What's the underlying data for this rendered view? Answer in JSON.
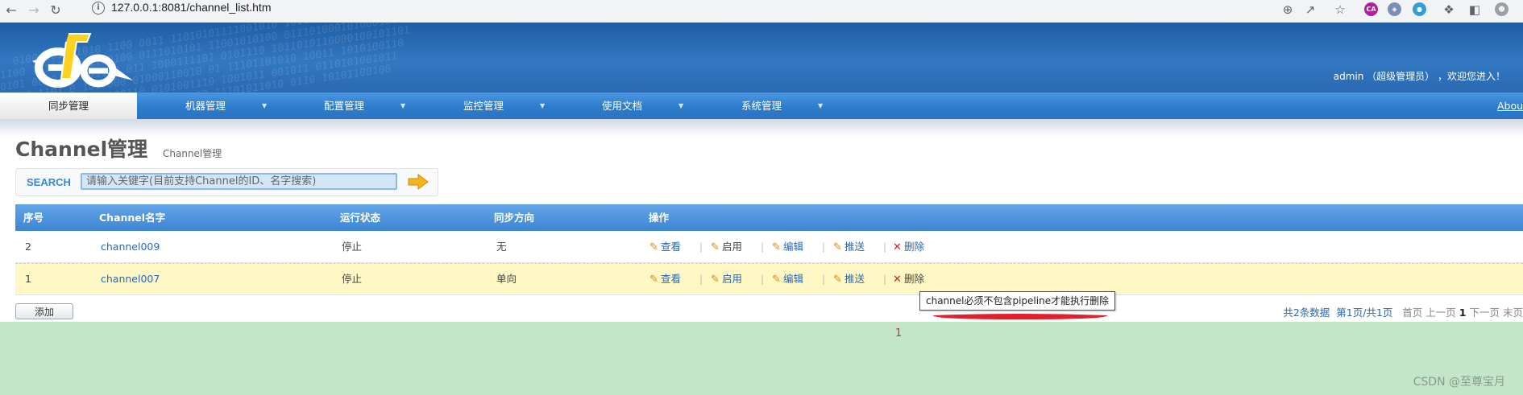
{
  "browser": {
    "url": "127.0.0.1:8081/channel_list.htm"
  },
  "header": {
    "user_info": "admin （超级管理员） ，欢迎您进入！"
  },
  "nav": {
    "items": [
      "同步管理",
      "机器管理",
      "配置管理",
      "监控管理",
      "使用文档",
      "系统管理"
    ],
    "about": "Abou"
  },
  "page": {
    "title": "Channel管理",
    "subtitle": "Channel管理"
  },
  "search": {
    "label": "SEARCH",
    "placeholder": "请输入关键字(目前支持Channel的ID、名字搜索)"
  },
  "table": {
    "headers": [
      "序号",
      "Channel名字",
      "运行状态",
      "同步方向",
      "操作"
    ],
    "rows": [
      {
        "id": "2",
        "name": "channel009",
        "status": "停止",
        "direction": "无"
      },
      {
        "id": "1",
        "name": "channel007",
        "status": "停止",
        "direction": "单向"
      }
    ],
    "ops": {
      "view": "查看",
      "enable": "启用",
      "edit": "编辑",
      "push": "推送",
      "delete": "删除"
    }
  },
  "tooltip": "channel必须不包含pipeline才能执行删除",
  "add_button": "添加",
  "pager": {
    "total": "共2条数据",
    "pages": "第1页/共1页",
    "first": "首页",
    "prev": "上一页",
    "current": "1",
    "next": "下一页",
    "last": "末页"
  },
  "footer": {
    "page_number": "1",
    "watermark": "CSDN @至尊宝月"
  },
  "colors": {
    "header_blue": "#2a6ab2",
    "nav_blue": "#2d7ccb",
    "link": "#2a67b1",
    "highlight_row": "#fff8c5",
    "footer_green": "#c4e6c8",
    "annotation_red": "#e0212b"
  }
}
